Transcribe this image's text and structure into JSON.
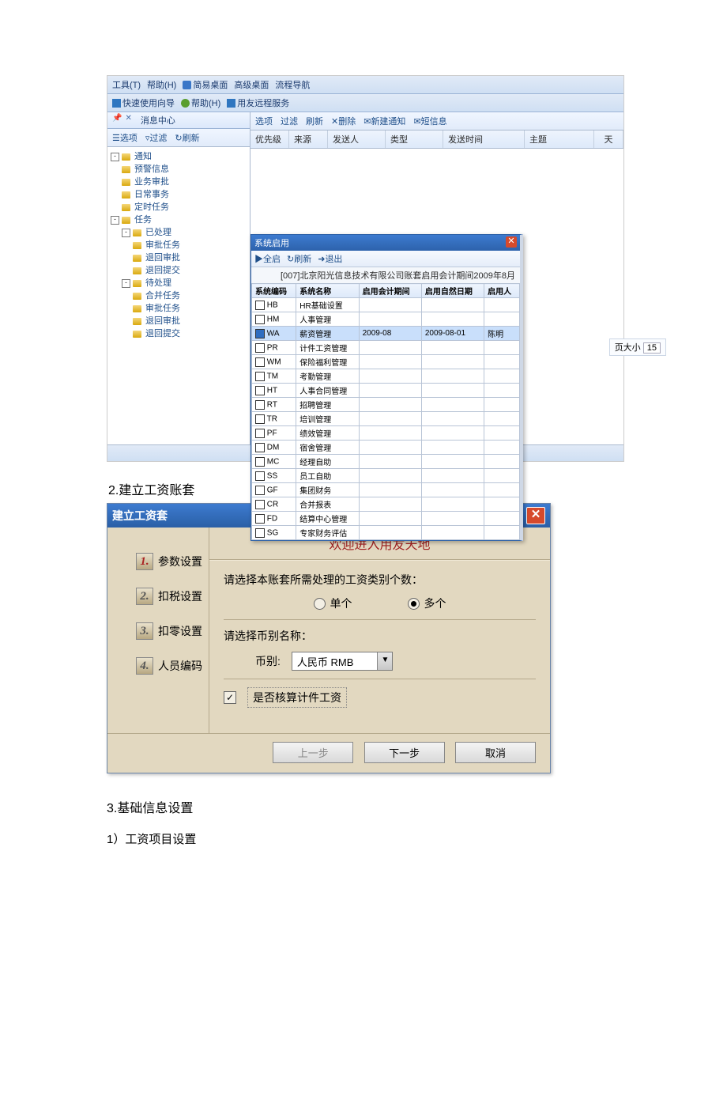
{
  "menubar": {
    "tools": "工具(T)",
    "help1": "帮助(H)",
    "simple": "简易桌面",
    "advanced": "高级桌面",
    "flownav": "流程导航",
    "quick": "快速使用向导",
    "help2": "帮助(H)",
    "flowsvc": "用友远程服务"
  },
  "tabTitle": "消息中心",
  "toolbar": {
    "opts": "选项",
    "filter": "过滤",
    "refresh": "刷新",
    "delete": "删除",
    "newnotice": "新建通知",
    "sms": "短信息"
  },
  "tree": [
    {
      "lvl": 0,
      "exp": "-",
      "txt": "通知"
    },
    {
      "lvl": 1,
      "txt": "预警信息"
    },
    {
      "lvl": 1,
      "txt": "业务审批"
    },
    {
      "lvl": 1,
      "txt": "日常事务"
    },
    {
      "lvl": 1,
      "txt": "定时任务"
    },
    {
      "lvl": 0,
      "exp": "-",
      "txt": "任务"
    },
    {
      "lvl": 1,
      "exp": "-",
      "txt": "已处理"
    },
    {
      "lvl": 2,
      "txt": "审批任务"
    },
    {
      "lvl": 2,
      "txt": "退回审批"
    },
    {
      "lvl": 2,
      "txt": "退回提交"
    },
    {
      "lvl": 1,
      "exp": "-",
      "txt": "待处理"
    },
    {
      "lvl": 2,
      "txt": "合并任务"
    },
    {
      "lvl": 2,
      "txt": "审批任务"
    },
    {
      "lvl": 2,
      "txt": "退回审批"
    },
    {
      "lvl": 2,
      "txt": "退回提交"
    }
  ],
  "notice_headers": [
    "优先级",
    "来源",
    "发送人",
    "类型",
    "发送时间",
    "主题",
    "天"
  ],
  "pagesize_label": "页大小",
  "pagesize_value": "15",
  "sysdlg": {
    "title": "系统启用",
    "tool": [
      "全启",
      "刷新",
      "退出"
    ],
    "info": "[007]北京阳光信息技术有限公司账套启用会计期间2009年8月",
    "headers": [
      "系统编码",
      "系统名称",
      "启用会计期间",
      "启用自然日期",
      "启用人"
    ],
    "rows": [
      {
        "c": false,
        "code": "HB",
        "name": "HR基础设置"
      },
      {
        "c": false,
        "code": "HM",
        "name": "人事管理"
      },
      {
        "c": true,
        "sel": true,
        "code": "WA",
        "name": "薪资管理",
        "p1": "2009-08",
        "p2": "2009-08-01",
        "p3": "陈明"
      },
      {
        "c": false,
        "code": "PR",
        "name": "计件工资管理"
      },
      {
        "c": false,
        "code": "WM",
        "name": "保险福利管理"
      },
      {
        "c": false,
        "code": "TM",
        "name": "考勤管理"
      },
      {
        "c": false,
        "code": "HT",
        "name": "人事合同管理"
      },
      {
        "c": false,
        "code": "RT",
        "name": "招聘管理"
      },
      {
        "c": false,
        "code": "TR",
        "name": "培训管理"
      },
      {
        "c": false,
        "code": "PF",
        "name": "绩效管理"
      },
      {
        "c": false,
        "code": "DM",
        "name": "宿舍管理"
      },
      {
        "c": false,
        "code": "MC",
        "name": "经理自助"
      },
      {
        "c": false,
        "code": "SS",
        "name": "员工自助"
      },
      {
        "c": false,
        "code": "GF",
        "name": "集团财务"
      },
      {
        "c": false,
        "code": "CR",
        "name": "合并报表"
      },
      {
        "c": false,
        "code": "FD",
        "name": "结算中心管理"
      },
      {
        "c": false,
        "code": "SG",
        "name": "专家财务评估"
      }
    ]
  },
  "cap2": "2.建立工资账套",
  "wizard": {
    "title": "建立工资套",
    "welcome": "欢迎进入用友天地",
    "steps": [
      "参数设置",
      "扣税设置",
      "扣零设置",
      "人员编码"
    ],
    "q1": "请选择本账套所需处理的工资类别个数：",
    "r1": "单个",
    "r2": "多个",
    "q2": "请选择币别名称：",
    "curr_label": "币别:",
    "curr_value": "人民币 RMB",
    "chk_label": "是否核算计件工资",
    "btn_prev": "上一步",
    "btn_next": "下一步",
    "btn_cancel": "取消"
  },
  "cap3": "3.基础信息设置",
  "cap31": "1）工资项目设置"
}
